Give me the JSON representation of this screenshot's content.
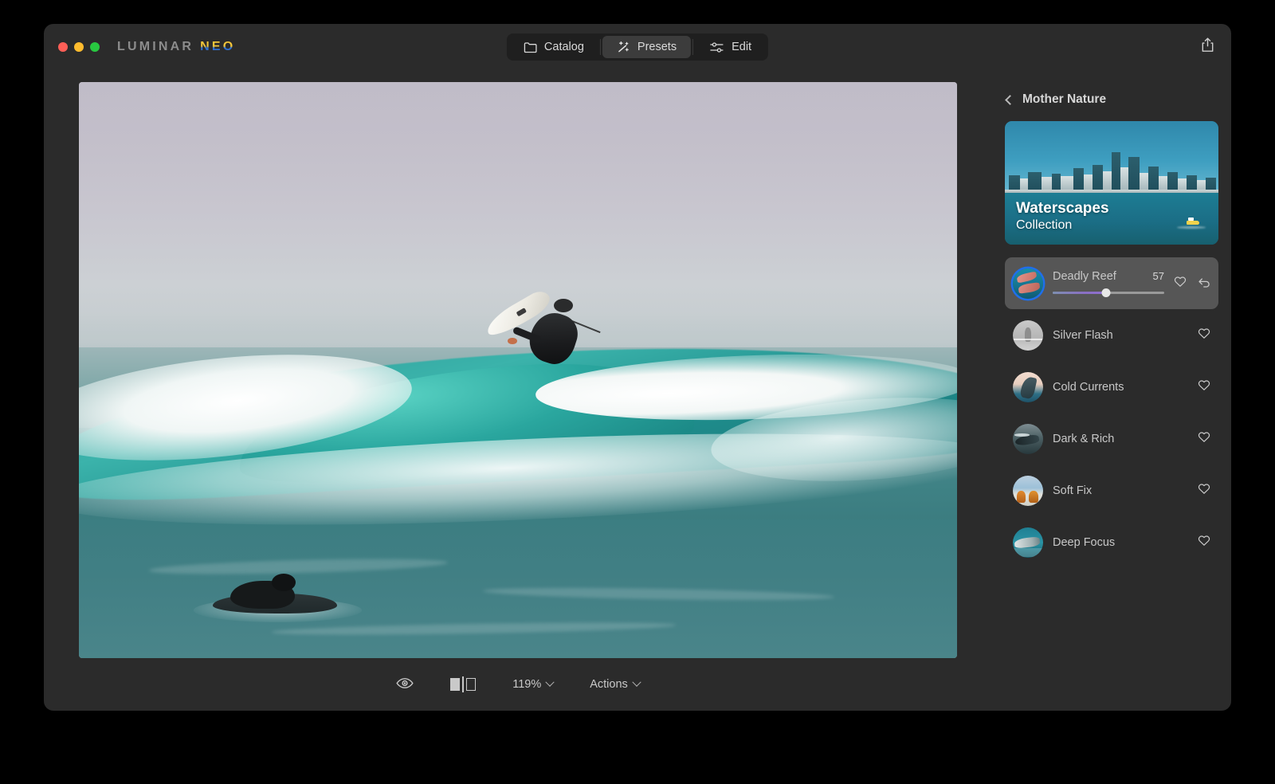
{
  "app": {
    "brand_first": "LUMINAR",
    "brand_second": "NEO",
    "accent_blue": "#1f6feb",
    "window_bg": "#2b2b2b"
  },
  "titlebar": {
    "modes": [
      {
        "label": "Catalog",
        "icon": "folder-icon",
        "active": false
      },
      {
        "label": "Presets",
        "icon": "sparkle-icon",
        "active": true
      },
      {
        "label": "Edit",
        "icon": "sliders-icon",
        "active": false
      }
    ],
    "share_icon": "share-icon"
  },
  "canvas": {
    "photo_alt": "Surfer riding a breaking teal wave with a second surfer paddling"
  },
  "bottom_toolbar": {
    "preview_icon": "eye-icon",
    "compare_icon": "before-after-icon",
    "zoom_level": "119%",
    "actions_label": "Actions"
  },
  "right_panel": {
    "back_icon": "chevron-left-icon",
    "title": "Mother Nature",
    "collection": {
      "title": "Waterscapes",
      "subtitle": "Collection"
    },
    "presets": [
      {
        "name": "Deadly Reef",
        "value": "57",
        "amount": 57,
        "selected": true,
        "thumb": "th-reef",
        "favorite_icon": "heart-icon",
        "reset_icon": "reset-icon"
      },
      {
        "name": "Silver Flash",
        "value": "",
        "selected": false,
        "thumb": "th-silver",
        "favorite_icon": "heart-icon"
      },
      {
        "name": "Cold Currents",
        "value": "",
        "selected": false,
        "thumb": "th-cold",
        "favorite_icon": "heart-icon"
      },
      {
        "name": "Dark & Rich",
        "value": "",
        "selected": false,
        "thumb": "th-dark",
        "favorite_icon": "heart-icon"
      },
      {
        "name": "Soft Fix",
        "value": "",
        "selected": false,
        "thumb": "th-soft",
        "favorite_icon": "heart-icon"
      },
      {
        "name": "Deep Focus",
        "value": "",
        "selected": false,
        "thumb": "th-deep",
        "favorite_icon": "heart-icon"
      }
    ]
  }
}
